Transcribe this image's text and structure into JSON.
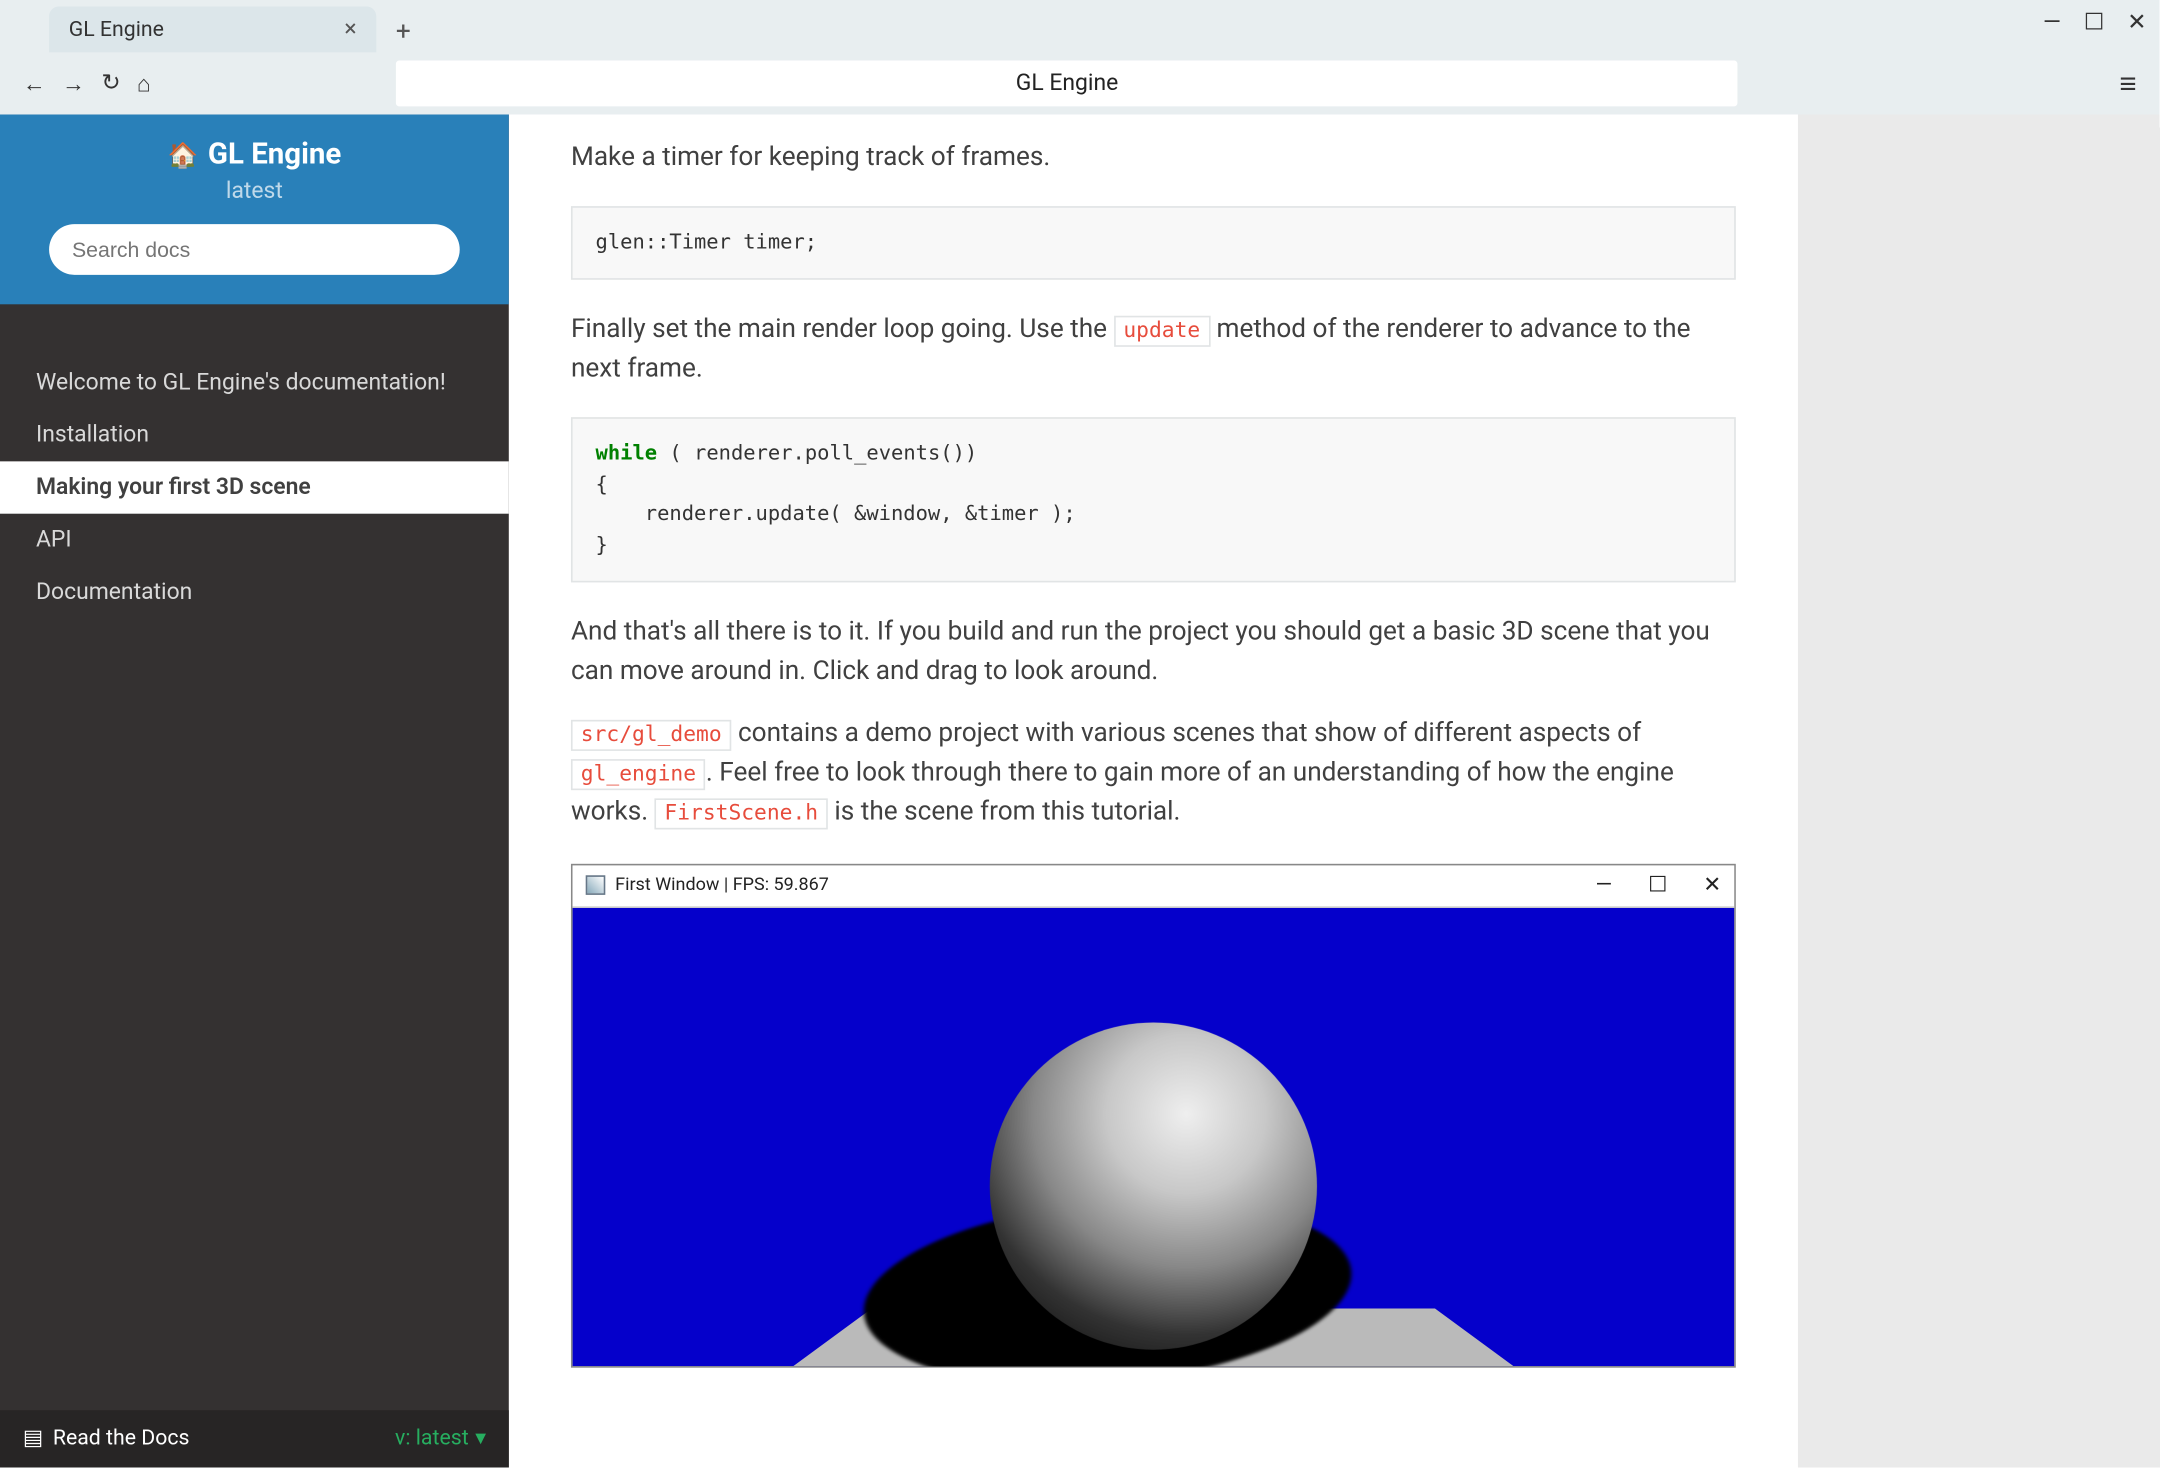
{
  "browser": {
    "tab_title": "GL Engine",
    "address": "GL Engine"
  },
  "sidebar": {
    "title": "GL Engine",
    "version": "latest",
    "search_placeholder": "Search docs",
    "items": [
      {
        "label": "Welcome to GL Engine's documentation!"
      },
      {
        "label": "Installation"
      },
      {
        "label": "Making your first 3D scene"
      },
      {
        "label": "API"
      },
      {
        "label": "Documentation"
      }
    ],
    "active_index": 2,
    "footer_rtd": "Read the Docs",
    "footer_version": "v: latest"
  },
  "content": {
    "p1": "Make a timer for keeping track of frames.",
    "code1": "glen::Timer timer;",
    "p2_a": "Finally set the main render loop going. Use the ",
    "p2_code": "update",
    "p2_b": " method of the renderer to advance to the next frame.",
    "code2_kw": "while",
    "code2_rest": " ( renderer.poll_events())\n{\n    renderer.update( &window, &timer );\n}",
    "p3": "And that's all there is to it. If you build and run the project you should get a basic 3D scene that you can move around in. Click and drag to look around.",
    "p4_c1": "src/gl_demo",
    "p4_a": " contains a demo project with various scenes that show of different aspects of ",
    "p4_c2": "gl_engine",
    "p4_b": ". Feel free to look through there to gain more of an understanding of how the engine works. ",
    "p4_c3": "FirstScene.h",
    "p4_c": " is the scene from this tutorial.",
    "appwin_title": "First Window | FPS: 59.867"
  }
}
